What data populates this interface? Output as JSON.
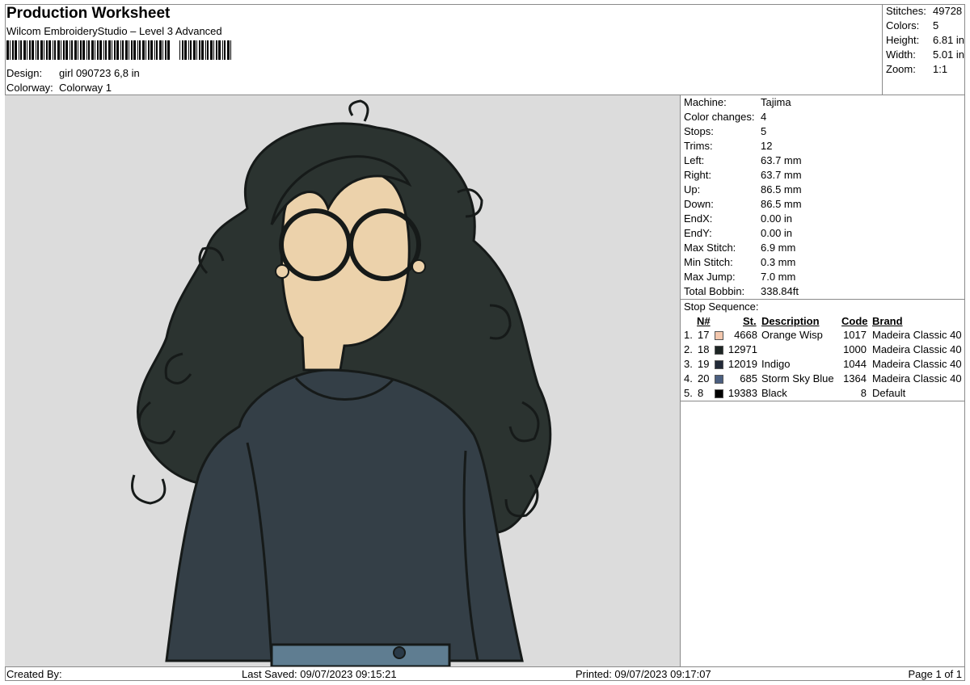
{
  "header": {
    "title": "Production Worksheet",
    "subtitle": "Wilcom EmbroideryStudio – Level 3 Advanced",
    "design_label": "Design:",
    "design_value": "girl 090723 6,8 in",
    "colorway_label": "Colorway:",
    "colorway_value": "Colorway 1"
  },
  "stats": [
    {
      "label": "Stitches:",
      "value": "49728"
    },
    {
      "label": "Colors:",
      "value": "5"
    },
    {
      "label": "Height:",
      "value": "6.81 in"
    },
    {
      "label": "Width:",
      "value": "5.01 in"
    },
    {
      "label": "Zoom:",
      "value": "1:1"
    }
  ],
  "machine_info": [
    {
      "label": "Machine:",
      "value": "Tajima"
    },
    {
      "label": "Color changes:",
      "value": "4"
    },
    {
      "label": "Stops:",
      "value": "5"
    },
    {
      "label": "Trims:",
      "value": "12"
    },
    {
      "label": "Left:",
      "value": "63.7 mm"
    },
    {
      "label": "Right:",
      "value": "63.7 mm"
    },
    {
      "label": "Up:",
      "value": "86.5 mm"
    },
    {
      "label": "Down:",
      "value": "86.5 mm"
    },
    {
      "label": "EndX:",
      "value": "0.00 in"
    },
    {
      "label": "EndY:",
      "value": "0.00 in"
    },
    {
      "label": "Max Stitch:",
      "value": "6.9 mm"
    },
    {
      "label": "Min Stitch:",
      "value": "0.3 mm"
    },
    {
      "label": "Max Jump:",
      "value": "7.0 mm"
    },
    {
      "label": "Total Bobbin:",
      "value": "338.84ft"
    }
  ],
  "stop_sequence": {
    "title": "Stop Sequence:",
    "headers": {
      "n": "N#",
      "st": "St.",
      "description": "Description",
      "code": "Code",
      "brand": "Brand"
    },
    "rows": [
      {
        "index": "1.",
        "n": "17",
        "st": "4668",
        "description": "Orange Wisp",
        "code": "1017",
        "brand": "Madeira Classic 40",
        "color": "#f3c7ad"
      },
      {
        "index": "2.",
        "n": "18",
        "st": "12971",
        "description": "",
        "code": "1000",
        "brand": "Madeira Classic 40",
        "color": "#1d2524"
      },
      {
        "index": "3.",
        "n": "19",
        "st": "12019",
        "description": "Indigo",
        "code": "1044",
        "brand": "Madeira Classic 40",
        "color": "#222a38"
      },
      {
        "index": "4.",
        "n": "20",
        "st": "685",
        "description": "Storm Sky Blue",
        "code": "1364",
        "brand": "Madeira Classic 40",
        "color": "#4b5f80"
      },
      {
        "index": "5.",
        "n": "8",
        "st": "19383",
        "description": "Black",
        "code": "8",
        "brand": "Default",
        "color": "#000000"
      }
    ]
  },
  "footer": {
    "created_by": "Created By:",
    "last_saved": "Last Saved: 09/07/2023 09:15:21",
    "printed": "Printed: 09/07/2023 09:17:07",
    "page": "Page 1 of 1"
  },
  "colors": {
    "preview_bg": "#dcdcdc",
    "hair": "#2b3330",
    "skin": "#ecd2ab",
    "sweater": "#343f47",
    "jeans": "#5f7d91"
  }
}
